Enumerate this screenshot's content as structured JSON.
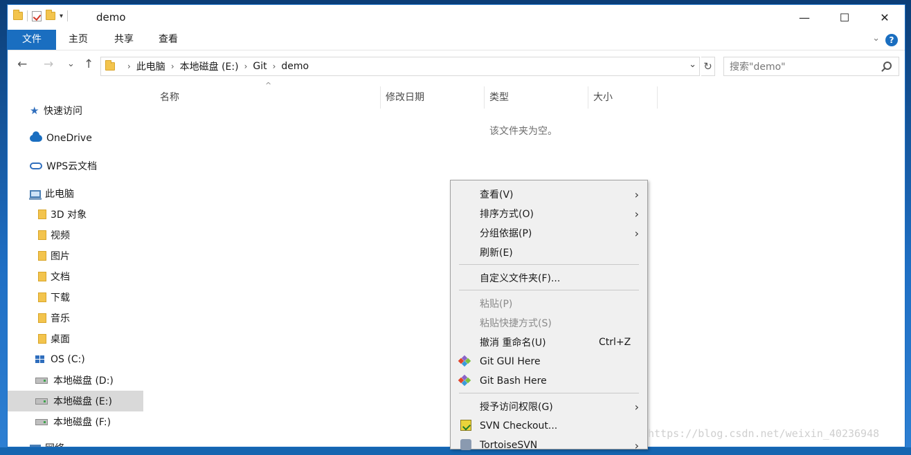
{
  "window": {
    "title": "demo"
  },
  "ribbon": {
    "tabs": [
      "文件",
      "主页",
      "共享",
      "查看"
    ],
    "help": "?"
  },
  "window_controls": {
    "minimize": "—",
    "maximize": "☐",
    "close": "✕"
  },
  "nav": {
    "back": "←",
    "forward": "→",
    "recent": "⌄",
    "up": "↑"
  },
  "address": {
    "crumbs": [
      "此电脑",
      "本地磁盘 (E:)",
      "Git",
      "demo"
    ]
  },
  "search": {
    "placeholder": "搜索\"demo\""
  },
  "sidebar": {
    "items": [
      {
        "label": "快速访问"
      },
      {
        "label": "OneDrive"
      },
      {
        "label": "WPS云文档"
      },
      {
        "label": "此电脑"
      },
      {
        "label": "3D 对象"
      },
      {
        "label": "视频"
      },
      {
        "label": "图片"
      },
      {
        "label": "文档"
      },
      {
        "label": "下载"
      },
      {
        "label": "音乐"
      },
      {
        "label": "桌面"
      },
      {
        "label": "OS (C:)"
      },
      {
        "label": "本地磁盘 (D:)"
      },
      {
        "label": "本地磁盘 (E:)"
      },
      {
        "label": "本地磁盘 (F:)"
      },
      {
        "label": "网络"
      }
    ],
    "selected": "本地磁盘 (E:)"
  },
  "columns": [
    "名称",
    "修改日期",
    "类型",
    "大小"
  ],
  "empty_message": "该文件夹为空。",
  "context_menu": {
    "items": [
      {
        "label": "查看(V)",
        "submenu": true
      },
      {
        "label": "排序方式(O)",
        "submenu": true
      },
      {
        "label": "分组依据(P)",
        "submenu": true
      },
      {
        "label": "刷新(E)"
      },
      {
        "label": "自定义文件夹(F)..."
      },
      {
        "label": "粘贴(P)",
        "disabled": true
      },
      {
        "label": "粘贴快捷方式(S)",
        "disabled": true
      },
      {
        "label": "撤消 重命名(U)",
        "shortcut": "Ctrl+Z"
      },
      {
        "label": "Git GUI Here",
        "icon": "git-icon"
      },
      {
        "label": "Git Bash Here",
        "icon": "git-icon"
      },
      {
        "label": "授予访问权限(G)",
        "submenu": true
      },
      {
        "label": "SVN Checkout...",
        "icon": "svn-icon"
      },
      {
        "label": "TortoiseSVN",
        "submenu": true,
        "icon": "tortoisesvn-icon"
      }
    ]
  },
  "watermark": "https://blog.csdn.net/weixin_40236948",
  "colors": {
    "accent": "#1a6ec0",
    "menu_bg": "#f0f0f0",
    "selected_bg": "#d9d9d9"
  }
}
